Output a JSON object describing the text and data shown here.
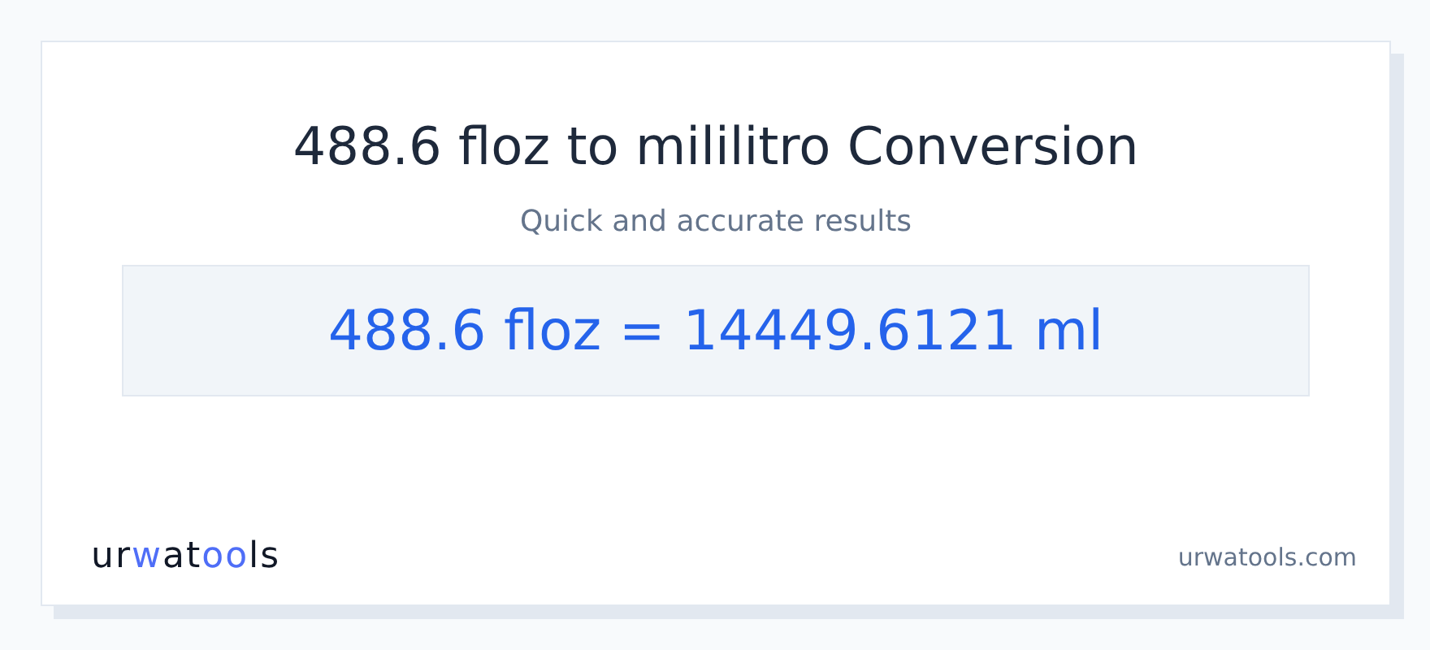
{
  "title": "488.6 floz to mililitro Conversion",
  "subtitle": "Quick and accurate results",
  "result": "488.6 floz = 14449.6121 ml",
  "logo": [
    {
      "text": "ur",
      "accent": false
    },
    {
      "text": "w",
      "accent": true
    },
    {
      "text": "at",
      "accent": false
    },
    {
      "text": "oo",
      "accent": true
    },
    {
      "text": "ls",
      "accent": false
    }
  ],
  "site": "urwatools.com"
}
